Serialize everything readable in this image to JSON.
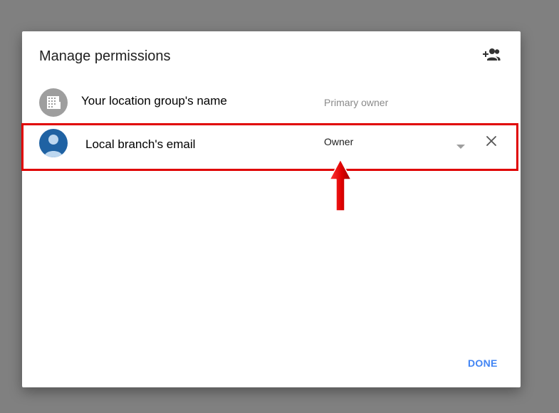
{
  "dialog": {
    "title": "Manage permissions",
    "add_person_icon": "person-add-icon",
    "done_label": "DONE"
  },
  "permissions": [
    {
      "name": "Your location group's name",
      "role": "Primary owner",
      "avatar_icon": "building-icon",
      "avatar_color": "#9e9e9e"
    },
    {
      "name": "Local branch's email",
      "role": "Owner",
      "avatar_icon": "person-icon",
      "avatar_color": "#1f62a3",
      "dropdown_icon": "caret-down-icon",
      "remove_icon": "close-icon"
    }
  ],
  "annotation": {
    "highlight_color": "#e00000",
    "arrow_icon": "red-arrow-up-icon"
  },
  "colors": {
    "overlay": "#808080",
    "accent": "#4285f4"
  }
}
